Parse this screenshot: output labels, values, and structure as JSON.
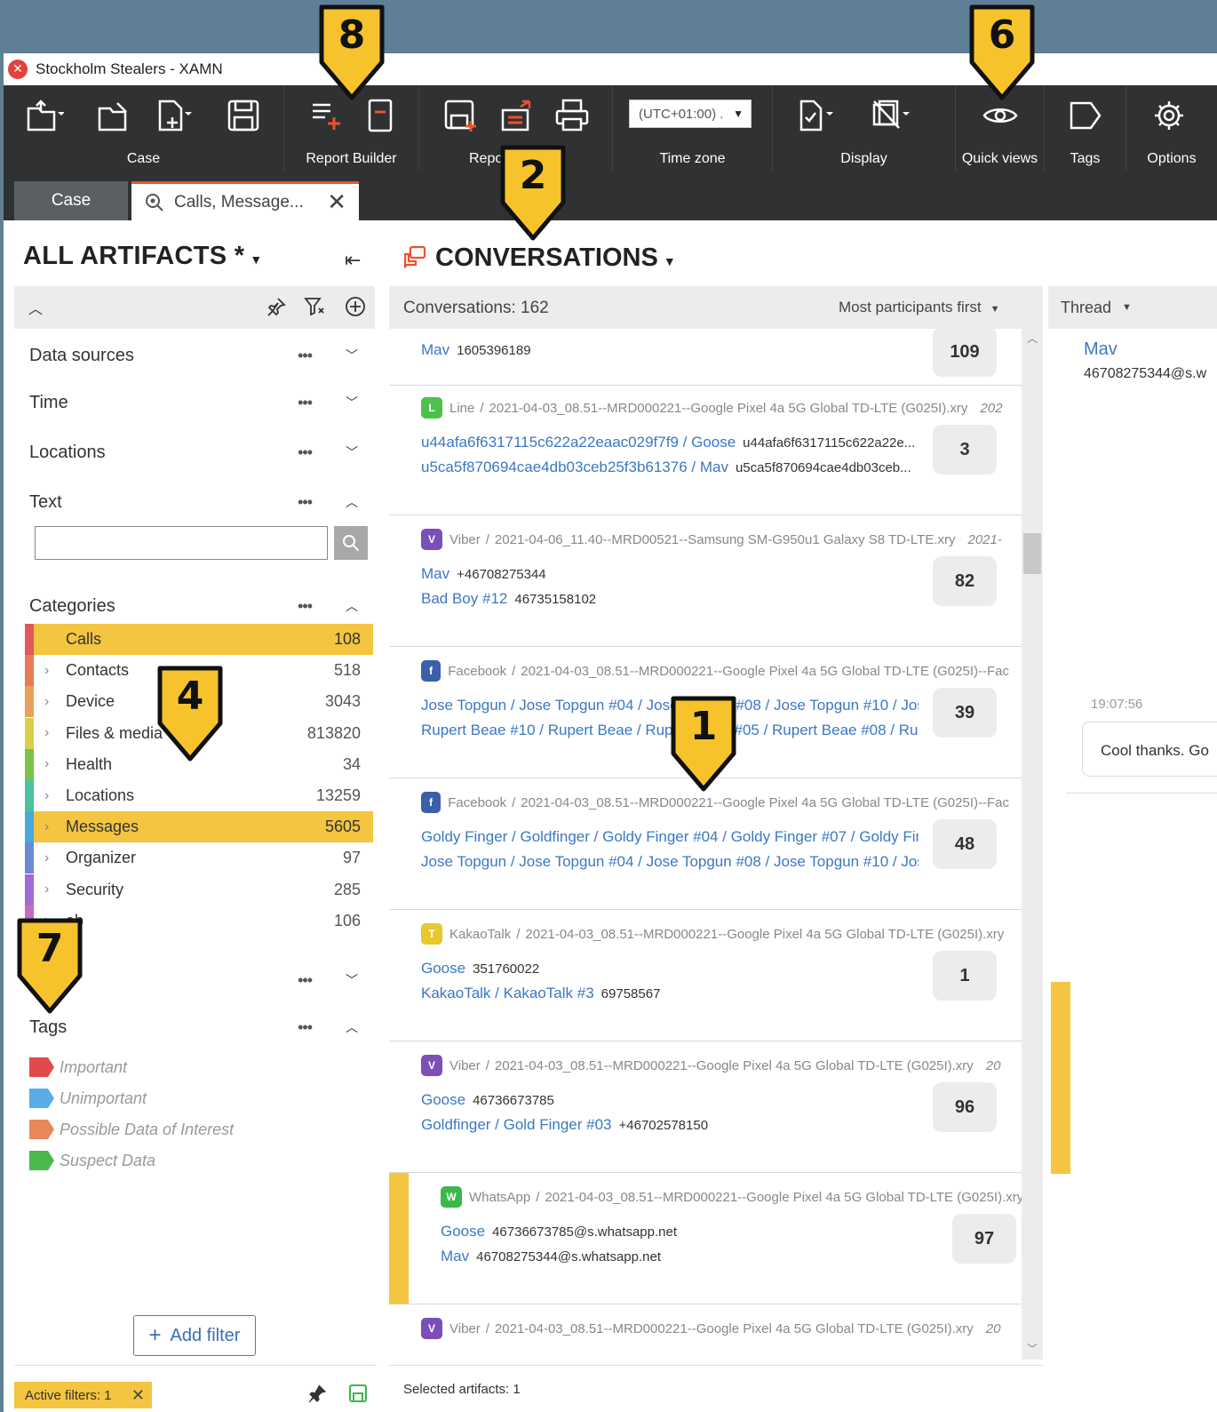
{
  "window": {
    "title": "Stockholm Stealers - XAMN"
  },
  "toolbar": {
    "groups": [
      {
        "label": "Case"
      },
      {
        "label": "Report Builder"
      },
      {
        "label": "Repo"
      },
      {
        "label": "Time zone"
      },
      {
        "label": "Display"
      },
      {
        "label": "Quick views"
      },
      {
        "label": "Tags"
      },
      {
        "label": "Options"
      }
    ],
    "timezone_value": "(UTC+01:00) ."
  },
  "tabs": [
    {
      "label": "Case"
    },
    {
      "label": "Calls, Message..."
    }
  ],
  "left": {
    "title": "ALL ARTIFACTS *",
    "filters": [
      {
        "label": "Data sources",
        "dots": "•••",
        "chev": "⌄"
      },
      {
        "label": "Time",
        "dots": "•••",
        "chev": "⌄"
      },
      {
        "label": "Locations",
        "dots": "•••",
        "chev": "⌄"
      },
      {
        "label": "Text",
        "dots": "•••",
        "chev": "⌃"
      }
    ],
    "categories_label": "Categories",
    "categories": [
      {
        "name": "Calls",
        "count": "108",
        "color": "#e05a5a"
      },
      {
        "name": "Contacts",
        "count": "518",
        "color": "#e87a5a"
      },
      {
        "name": "Device",
        "count": "3043",
        "color": "#e8a05a"
      },
      {
        "name": "Files & media",
        "count": "813820",
        "color": "#d9cf4a"
      },
      {
        "name": "Health",
        "count": "34",
        "color": "#7ac24a"
      },
      {
        "name": "Locations",
        "count": "13259",
        "color": "#4ac2a0"
      },
      {
        "name": "Messages",
        "count": "5605",
        "color": "#4aa8d9"
      },
      {
        "name": "Organizer",
        "count": "97",
        "color": "#6a8ad9"
      },
      {
        "name": "Security",
        "count": "285",
        "color": "#a06ad9"
      },
      {
        "name": "eb",
        "count": "106",
        "color": "#c86ac2"
      }
    ],
    "tags_label": "Tags",
    "tags": [
      {
        "name": "Important",
        "color": "#e04a4a"
      },
      {
        "name": "Unimportant",
        "color": "#5aace8"
      },
      {
        "name": "Possible Data of Interest",
        "color": "#e8885a"
      },
      {
        "name": "Suspect Data",
        "color": "#4ab84a"
      }
    ],
    "add_filter": "Add filter",
    "active_filters": "Active filters: 1"
  },
  "middle": {
    "title": "CONVERSATIONS",
    "count_label": "Conversations: 162",
    "sort_label": "Most participants first",
    "selected": "Selected artifacts: 1",
    "conversations": [
      {
        "app": "",
        "source": "",
        "date": "",
        "lines": [
          {
            "names": "Mav",
            "num": "1605396189"
          }
        ],
        "count": "109"
      },
      {
        "app": "Line",
        "source": "2021-04-03_08.51--MRD000221--Google Pixel 4a 5G Global TD-LTE (G025I).xry",
        "date": "202",
        "icon_color": "#4cc24c",
        "icon_glyph": "L",
        "lines": [
          {
            "names": "u44afa6f6317115c622a22eaac029f7f9 / Goose",
            "num": "u44afa6f6317115c622a22e..."
          },
          {
            "names": "u5ca5f870694cae4db03ceb25f3b61376 / Mav",
            "num": "u5ca5f870694cae4db03ceb..."
          }
        ],
        "count": "3"
      },
      {
        "app": "Viber",
        "source": "2021-04-06_11.40--MRD00521--Samsung SM-G950u1 Galaxy S8 TD-LTE.xry",
        "date": "2021-",
        "icon_color": "#7a4fb8",
        "icon_glyph": "V",
        "lines": [
          {
            "names": "Mav",
            "num": "+46708275344"
          },
          {
            "names": "Bad Boy #12",
            "num": "46735158102"
          }
        ],
        "count": "82"
      },
      {
        "app": "Facebook",
        "source": "2021-04-03_08.51--MRD000221--Google Pixel 4a 5G Global TD-LTE (G025I)--Fac",
        "date": "",
        "icon_color": "#3b5fa8",
        "icon_glyph": "f",
        "lines": [
          {
            "names": "Jose Topgun / Jose Topgun #04 / Jose Topgun #08 / Jose Topgun #10 / Jose",
            "num": ""
          },
          {
            "names": "Rupert Beae #10 / Rupert Beae / Rupert Beae #05 / Rupert Beae #08 / Rupe",
            "num": ""
          }
        ],
        "count": "39"
      },
      {
        "app": "Facebook",
        "source": "2021-04-03_08.51--MRD000221--Google Pixel 4a 5G Global TD-LTE (G025I)--Fac",
        "date": "",
        "icon_color": "#3b5fa8",
        "icon_glyph": "f",
        "lines": [
          {
            "names": "Goldy Finger / Goldfinger / Goldy Finger #04 / Goldy Finger #07 / Goldy Fir",
            "num": ""
          },
          {
            "names": "Jose Topgun / Jose Topgun #04 / Jose Topgun #08 / Jose Topgun #10 / Jose",
            "num": ""
          }
        ],
        "count": "48"
      },
      {
        "app": "KakaoTalk",
        "source": "2021-04-03_08.51--MRD000221--Google Pixel 4a 5G Global TD-LTE (G025I).xry",
        "date": "",
        "icon_color": "#e8c82a",
        "icon_glyph": "T",
        "lines": [
          {
            "names": "Goose",
            "num": "351760022"
          },
          {
            "names": "KakaoTalk / KakaoTalk #3",
            "num": "69758567"
          }
        ],
        "count": "1"
      },
      {
        "app": "Viber",
        "source": "2021-04-03_08.51--MRD000221--Google Pixel 4a 5G Global TD-LTE (G025I).xry",
        "date": "20",
        "icon_color": "#7a4fb8",
        "icon_glyph": "V",
        "lines": [
          {
            "names": "Goose",
            "num": "46736673785"
          },
          {
            "names": "Goldfinger / Gold Finger #03",
            "num": "+46702578150"
          }
        ],
        "count": "96"
      },
      {
        "app": "WhatsApp",
        "source": "2021-04-03_08.51--MRD000221--Google Pixel 4a 5G Global TD-LTE (G025I).xry",
        "date": "",
        "icon_color": "#3ab84a",
        "icon_glyph": "W",
        "lines": [
          {
            "names": "Goose",
            "num": "46736673785@s.whatsapp.net"
          },
          {
            "names": "Mav",
            "num": "46708275344@s.whatsapp.net"
          }
        ],
        "count": "97"
      },
      {
        "app": "Viber",
        "source": "2021-04-03_08.51--MRD000221--Google Pixel 4a 5G Global TD-LTE (G025I).xry",
        "date": "20",
        "icon_color": "#7a4fb8",
        "icon_glyph": "V",
        "lines": [],
        "count": ""
      }
    ]
  },
  "right": {
    "thread_label": "Thread",
    "contact_name": "Mav",
    "contact_num": "46708275344@s.w",
    "time": "19:07:56",
    "message": "Cool thanks. Go"
  },
  "callouts": [
    "8",
    "6",
    "2",
    "4",
    "1",
    "7"
  ]
}
